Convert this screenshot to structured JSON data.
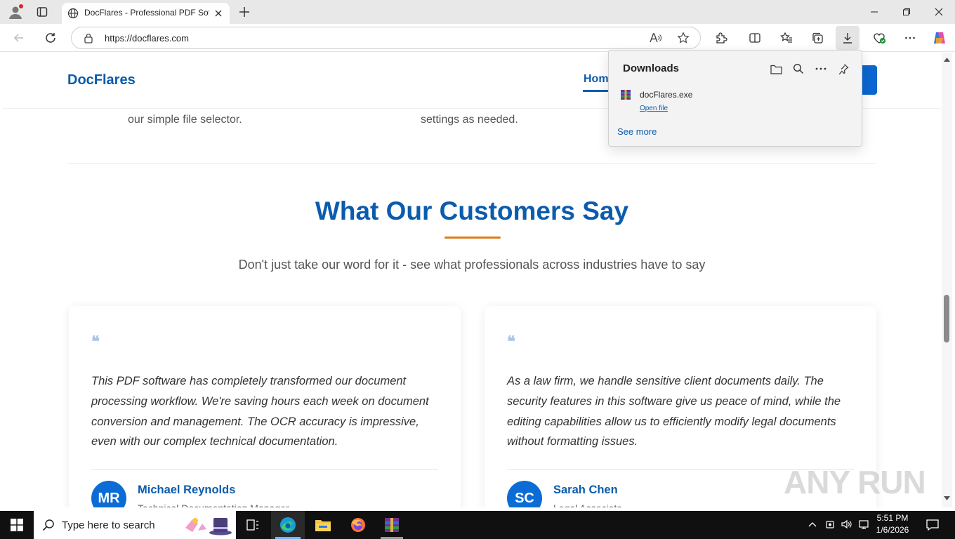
{
  "browser": {
    "tab_title": "DocFlares - Professional PDF Software",
    "url": "https://docflares.com"
  },
  "site": {
    "logo": "DocFlares",
    "nav_active": "Home"
  },
  "steps": {
    "left_text": "our simple file selector.",
    "middle_text": "settings as needed."
  },
  "testimonials": {
    "title": "What Our Customers Say",
    "subtitle": "Don't just take our word for it - see what professionals across industries have to say",
    "cards": [
      {
        "quote": "This PDF software has completely transformed our document processing workflow. We're saving hours each week on document conversion and management. The OCR accuracy is impressive, even with our complex technical documentation.",
        "initials": "MR",
        "name": "Michael Reynolds",
        "role": "Technical Documentation Manager"
      },
      {
        "quote": "As a law firm, we handle sensitive client documents daily. The security features in this software give us peace of mind, while the editing capabilities allow us to efficiently modify legal documents without formatting issues.",
        "initials": "SC",
        "name": "Sarah Chen",
        "role": "Legal Associate"
      }
    ]
  },
  "downloads": {
    "title": "Downloads",
    "file_name": "docFlares.exe",
    "open_file": "Open file",
    "see_more": "See more"
  },
  "taskbar": {
    "search_placeholder": "Type here to search",
    "time": "5:51 PM",
    "date": "1/6/2026"
  },
  "watermark": "ANY RUN",
  "colors": {
    "brand": "#0b5cad",
    "accent": "#e07b17"
  }
}
